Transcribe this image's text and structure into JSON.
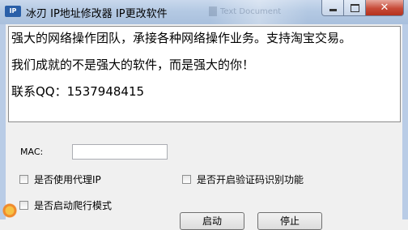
{
  "window": {
    "title": "冰刃 IP地址修改器 IP更改软件",
    "icon_label": "IP",
    "background_ghost": "Text Document",
    "controls": {
      "minimize": "minimize-icon",
      "maximize": "maximize-icon",
      "close": "close-icon",
      "close_glyph": "✕"
    }
  },
  "info": {
    "line1": "强大的网络操作团队，承接各种网络操作业务。支持淘宝交易。",
    "line2": "我们成就的不是强大的软件，而是强大的你！",
    "line3": "联系QQ：1537948415"
  },
  "form": {
    "mac_label": "MAC:",
    "mac_value": "",
    "options": [
      {
        "label": "是否使用代理IP",
        "checked": false
      },
      {
        "label": "是否开启验证码识别功能",
        "checked": false
      },
      {
        "label": "是否启动爬行模式",
        "checked": false
      }
    ]
  },
  "buttons": {
    "start": "启动",
    "stop": "停止"
  }
}
